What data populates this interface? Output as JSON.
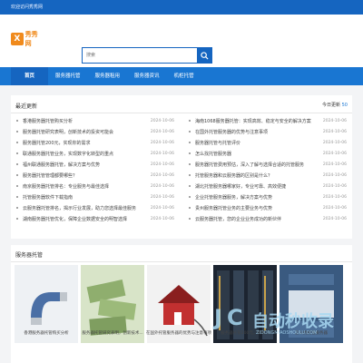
{
  "topbar": {
    "welcome": "欢迎访问秀秀网"
  },
  "logo": {
    "text": "秀秀网"
  },
  "search": {
    "placeholder": "搜索"
  },
  "nav": {
    "items": [
      "首页",
      "服务器托管",
      "服务器租用",
      "服务器资讯",
      "机柜托管"
    ]
  },
  "latest": {
    "title": "最近更新",
    "today_label": "今日更新",
    "today_count": "50",
    "left": [
      {
        "title": "香港服务器托管购买分析",
        "date": "2024-10-06"
      },
      {
        "title": "服务器托管研究表明，创新技术的投资可能会",
        "date": "2024-10-06"
      },
      {
        "title": "服务器托管200元，实现你的需求",
        "date": "2024-10-06"
      },
      {
        "title": "联通服务器托管业务，实现数字化转型的重点",
        "date": "2024-10-06"
      },
      {
        "title": "福州联通服务器托管，解决方案与优势",
        "date": "2024-10-06"
      },
      {
        "title": "服务器托管管理都要哪些？",
        "date": "2024-10-06"
      },
      {
        "title": "南京服务器托管排名：专业服务与最佳选择",
        "date": "2024-10-06"
      },
      {
        "title": "托管服务器软件下载指南",
        "date": "2024-10-06"
      },
      {
        "title": "云服务器托管排名，揭示行业发展，助力您选择最佳服务",
        "date": "2024-10-06"
      },
      {
        "title": "湖南服务器托管优化，保障企业数据安全的明智选择",
        "date": "2024-10-06"
      }
    ],
    "right": [
      {
        "title": "海南1068服务器托管：实现高效、稳定与安全的解决方案",
        "date": "2024-10-06"
      },
      {
        "title": "在国外托管服务器的优势与注意事项",
        "date": "2024-10-06"
      },
      {
        "title": "服务器托管与托管评价",
        "date": "2024-10-06"
      },
      {
        "title": "怎么找托管服务器",
        "date": "2024-10-06"
      },
      {
        "title": "服务器托管费用预估，深入了解与选择合适的托管服务",
        "date": "2024-10-06"
      },
      {
        "title": "托管服务器和云服务器的区别是什么？",
        "date": "2024-10-06"
      },
      {
        "title": "湖北托管服务器哪家好，专业可靠、高效便捷",
        "date": "2024-10-06"
      },
      {
        "title": "企业托管服务器服务，解决方案与优势",
        "date": "2024-10-06"
      },
      {
        "title": "贵州服务器托管业务的主要业务与优势",
        "date": "2024-10-06"
      },
      {
        "title": "云服务器托管，您的企业业务成功的新伙伴",
        "date": "2024-10-06"
      }
    ]
  },
  "hosting": {
    "title": "服务器托管",
    "items": [
      {
        "caption": "香港服务器托管购买分析"
      },
      {
        "caption": "服务器托管研究表明，创新技术..."
      },
      {
        "caption": "在国外托管服务器的优势与注意事项"
      },
      {
        "caption": "服务器托管200元，实现..."
      },
      {
        "caption": "怎么找托管服务器"
      }
    ]
  },
  "watermark": {
    "text": "自动秒收录",
    "sub": "ZIDONGMIAOSHOULU.COM"
  },
  "colors": {
    "brand_blue": "#1976d2",
    "topbar_blue": "#1565c0",
    "logo_orange": "#f08a1c"
  }
}
